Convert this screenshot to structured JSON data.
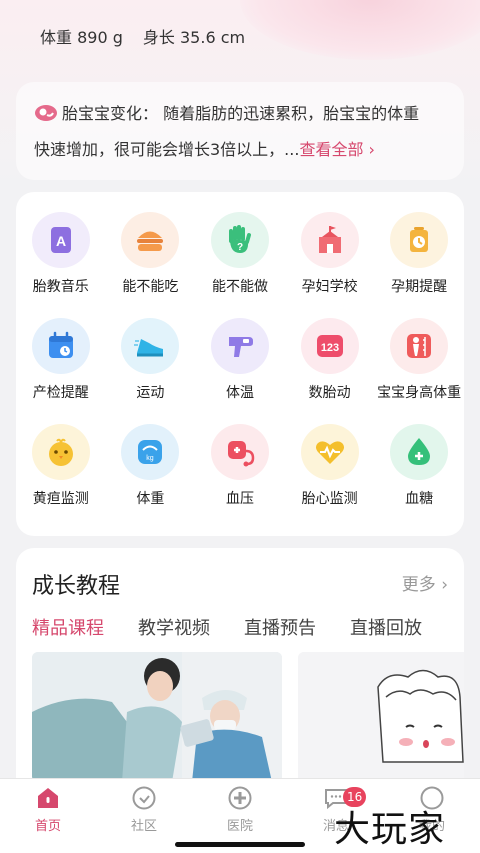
{
  "header": {
    "weight_label": "体重",
    "weight_value": "890 g",
    "length_label": "身长",
    "length_value": "35.6 cm"
  },
  "baby_change": {
    "icon": "fetus-icon",
    "text_line1": "胎宝宝变化： 随着脂肪的迅速累积，胎宝宝的体重",
    "text_line2": "快速增加，很可能会增长3倍以上，...",
    "more": "查看全部 ›"
  },
  "tools": [
    {
      "label": "胎教音乐",
      "icon": "music-icon"
    },
    {
      "label": "能不能吃",
      "icon": "burger-icon"
    },
    {
      "label": "能不能做",
      "icon": "hand-question-icon"
    },
    {
      "label": "孕妇学校",
      "icon": "school-icon"
    },
    {
      "label": "孕期提醒",
      "icon": "alarm-clock-icon"
    },
    {
      "label": "产检提醒",
      "icon": "calendar-icon"
    },
    {
      "label": "运动",
      "icon": "sneaker-icon"
    },
    {
      "label": "体温",
      "icon": "thermometer-icon"
    },
    {
      "label": "数胎动",
      "icon": "counter-123-icon"
    },
    {
      "label": "宝宝身高体重",
      "icon": "height-chart-icon"
    },
    {
      "label": "黄疸监测",
      "icon": "chick-icon"
    },
    {
      "label": "体重",
      "icon": "scale-icon"
    },
    {
      "label": "血压",
      "icon": "stethoscope-icon"
    },
    {
      "label": "胎心监测",
      "icon": "heartbeat-icon"
    },
    {
      "label": "血糖",
      "icon": "blood-drop-icon"
    }
  ],
  "course": {
    "title": "成长教程",
    "more": "更多 ›",
    "tabs": [
      "精品课程",
      "教学视频",
      "直播预告",
      "直播回放"
    ]
  },
  "tabbar": {
    "items": [
      {
        "label": "首页",
        "icon": "home-icon"
      },
      {
        "label": "社区",
        "icon": "community-icon"
      },
      {
        "label": "医院",
        "icon": "hospital-icon"
      },
      {
        "label": "消息",
        "icon": "message-icon"
      },
      {
        "label": "我的",
        "icon": "profile-icon"
      }
    ],
    "badge": "16"
  },
  "watermark": "大玩家",
  "colors": {
    "accent": "#d6486d",
    "badge": "#e8435e"
  }
}
